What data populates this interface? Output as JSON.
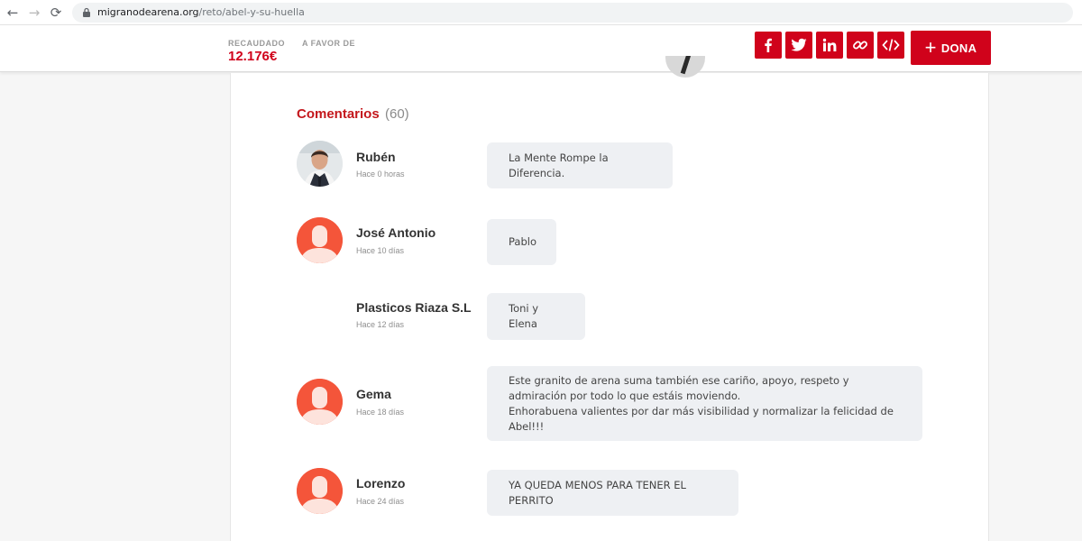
{
  "browser": {
    "url_host": "migranodearena.org",
    "url_path": "/reto/abel-y-su-huella"
  },
  "header": {
    "raised_label": "RECAUDADO",
    "favor_label": "A FAVOR DE",
    "raised_value": "12.176€",
    "donate_label": "DONA",
    "share_icons": [
      "facebook-icon",
      "twitter-icon",
      "linkedin-icon",
      "link-icon",
      "embed-code-icon"
    ],
    "accent_color": "#d0021b"
  },
  "comments_section": {
    "title": "Comentarios",
    "count": "(60)",
    "items": [
      {
        "name": "Rubén",
        "time": "Hace 0 horas",
        "text": "La Mente Rompe la Diferencia.",
        "avatar": "photo"
      },
      {
        "name": "José Antonio",
        "time": "Hace 10 días",
        "text": "Pablo",
        "avatar": "default-user-icon"
      },
      {
        "name": "Plasticos Riaza S.L",
        "time": "Hace 12 días",
        "text": "Toni y Elena",
        "avatar": "none"
      },
      {
        "name": "Gema",
        "time": "Hace 18 días",
        "text": "Este granito de arena suma también ese cariño, apoyo, respeto y admiración por todo lo que estáis moviendo.\nEnhorabuena valientes por dar más visibilidad y normalizar la felicidad de Abel!!!",
        "avatar": "default-user-icon"
      },
      {
        "name": "Lorenzo",
        "time": "Hace 24 días",
        "text": "YA QUEDA MENOS PARA TENER EL PERRITO",
        "avatar": "default-user-icon"
      }
    ]
  }
}
